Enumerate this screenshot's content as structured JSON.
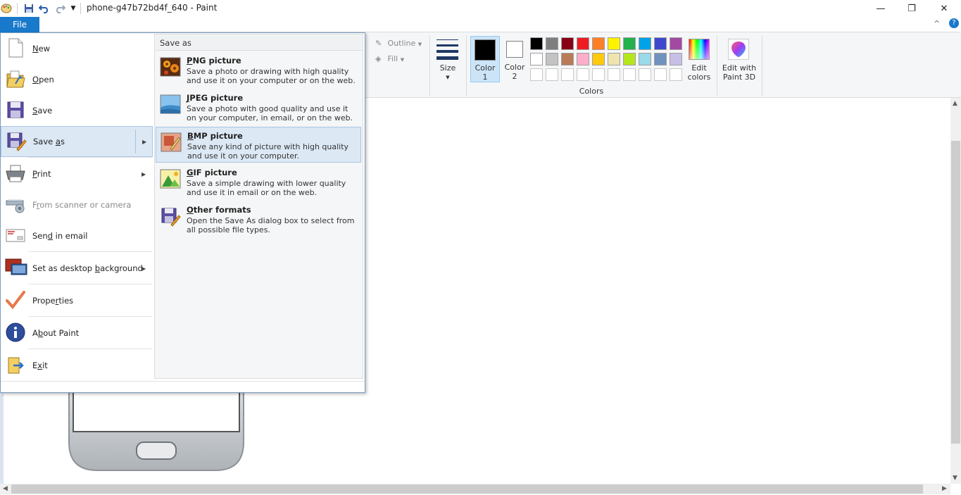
{
  "window": {
    "title": "phone-g47b72bd4f_640 - Paint"
  },
  "quick_access": {
    "app_icon": "paint-palette-icon",
    "save_icon": "save-icon",
    "undo_icon": "undo-icon",
    "redo_icon": "redo-icon",
    "customize_icon": "dropdown-icon"
  },
  "window_controls": {
    "minimize": "—",
    "restore": "❐",
    "close": "✕"
  },
  "ribbon": {
    "file_tab": "File",
    "help_icon": "?",
    "collapse_icon": "^",
    "outline_label": "Outline",
    "fill_label": "Fill",
    "size_label": "Size",
    "color1_label": [
      "Color",
      "1"
    ],
    "color2_label": [
      "Color",
      "2"
    ],
    "colors_group_label": "Colors",
    "edit_colors_label": [
      "Edit",
      "colors"
    ],
    "edit_paint3d_label": [
      "Edit with",
      "Paint 3D"
    ],
    "color1_value": "#000000",
    "color2_value": "#ffffff",
    "palette_row1": [
      "#000000",
      "#7f7f7f",
      "#880015",
      "#ed1c24",
      "#ff7f27",
      "#fff200",
      "#22b14c",
      "#00a2e8",
      "#3f48cc",
      "#a349a4"
    ],
    "palette_row2": [
      "#ffffff",
      "#c3c3c3",
      "#b97a57",
      "#ffaec9",
      "#ffc90e",
      "#efe4b0",
      "#b5e61d",
      "#99d9ea",
      "#7092be",
      "#c8bfe7"
    ]
  },
  "file_menu": {
    "items": [
      {
        "label": "New",
        "mnemonic_index": 0,
        "icon": "new-file-icon"
      },
      {
        "label": "Open",
        "mnemonic_index": 0,
        "icon": "open-folder-icon"
      },
      {
        "label": "Save",
        "mnemonic_index": 0,
        "icon": "save-icon"
      },
      {
        "label": "Save as",
        "mnemonic_index": 5,
        "icon": "save-as-icon"
      },
      {
        "label": "Print",
        "mnemonic_index": 0,
        "icon": "printer-icon"
      },
      {
        "label": "From scanner or camera",
        "mnemonic_index": 1,
        "icon": "scanner-icon"
      },
      {
        "label": "Send in email",
        "mnemonic_index": 3,
        "icon": "email-icon"
      },
      {
        "label": "Set as desktop background",
        "mnemonic_index": 15,
        "icon": "desktop-background-icon"
      },
      {
        "label": "Properties",
        "mnemonic_index": 5,
        "icon": "checkmark-icon"
      },
      {
        "label": "About Paint",
        "mnemonic_index": 1,
        "icon": "info-icon"
      },
      {
        "label": "Exit",
        "mnemonic_index": 1,
        "icon": "exit-icon"
      }
    ]
  },
  "save_as_submenu": {
    "header": "Save as",
    "items": [
      {
        "title": "PNG picture",
        "description": "Save a photo or drawing with high quality and use it on your computer or on the web.",
        "icon": "png-picture-icon"
      },
      {
        "title": "JPEG picture",
        "description": "Save a photo with good quality and use it on your computer, in email, or on the web.",
        "icon": "jpeg-picture-icon"
      },
      {
        "title": "BMP picture",
        "description": "Save any kind of picture with high quality and use it on your computer.",
        "icon": "bmp-picture-icon"
      },
      {
        "title": "GIF picture",
        "description": "Save a simple drawing with lower quality and use it in email or on the web.",
        "icon": "gif-picture-icon"
      },
      {
        "title": "Other formats",
        "description": "Open the Save As dialog box to select from all possible file types.",
        "icon": "other-formats-icon"
      }
    ]
  }
}
